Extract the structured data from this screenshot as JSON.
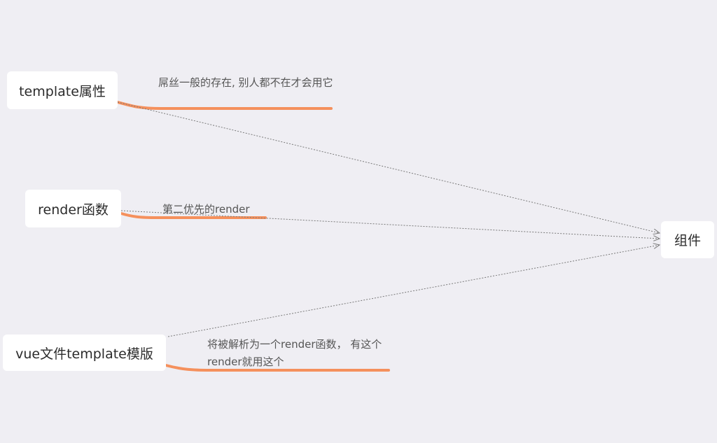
{
  "nodes": {
    "template_attr": "template属性",
    "render_func": "render函数",
    "vue_file_template": "vue文件template模版",
    "component": "组件"
  },
  "notes": {
    "template_attr": "屌丝一般的存在, 别人都不在才会用它",
    "render_func": "第二优先的render",
    "vue_file_template": "将被解析为一个render函数， 有这个render就用这个"
  },
  "colors": {
    "background": "#efeef3",
    "node_fill": "#ffffff",
    "underline": "#f5905c",
    "arrow": "#7a7a7a"
  }
}
